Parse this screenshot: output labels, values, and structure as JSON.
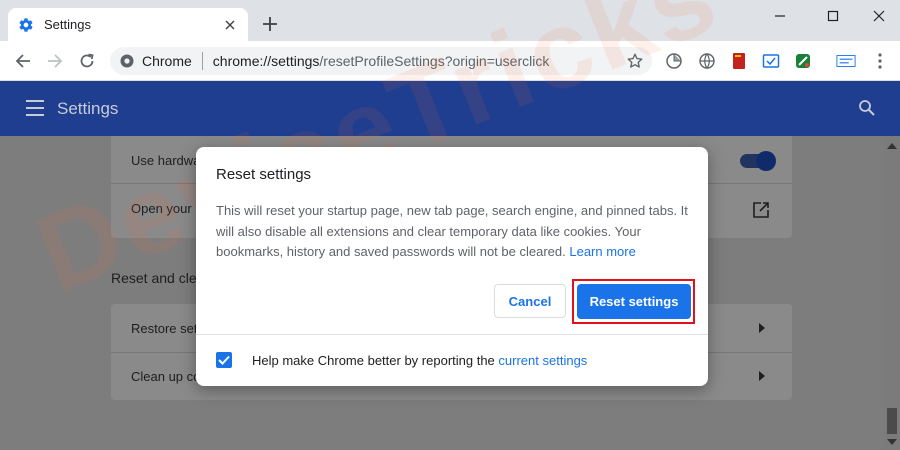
{
  "tab": {
    "title": "Settings",
    "new_tab_symbol": "+"
  },
  "omnibox": {
    "site_label": "Chrome",
    "url_host": "chrome://settings",
    "url_path": "/resetProfileSettings?origin=userclick"
  },
  "header": {
    "title": "Settings"
  },
  "page": {
    "rows": [
      {
        "label": "Use hardwa"
      },
      {
        "label": "Open your c"
      },
      {
        "label": "Restore set"
      },
      {
        "label": "Clean up co"
      }
    ],
    "section_title": "Reset and cle"
  },
  "dialog": {
    "title": "Reset settings",
    "body": "This will reset your startup page, new tab page, search engine, and pinned tabs. It will also disable all extensions and clear temporary data like cookies. Your bookmarks, history and saved passwords will not be cleared.",
    "learn_more": "Learn more",
    "cancel_label": "Cancel",
    "reset_label": "Reset settings",
    "footer_text": "Help make Chrome better by reporting the",
    "footer_link": "current settings",
    "checkbox_checked": true
  },
  "watermark": {
    "text": "DeviceTricks"
  },
  "colors": {
    "accent": "#1a73e8",
    "header_bg": "#1f3e8f",
    "highlight": "#e5101d",
    "tabstrip": "#dee1e6"
  }
}
